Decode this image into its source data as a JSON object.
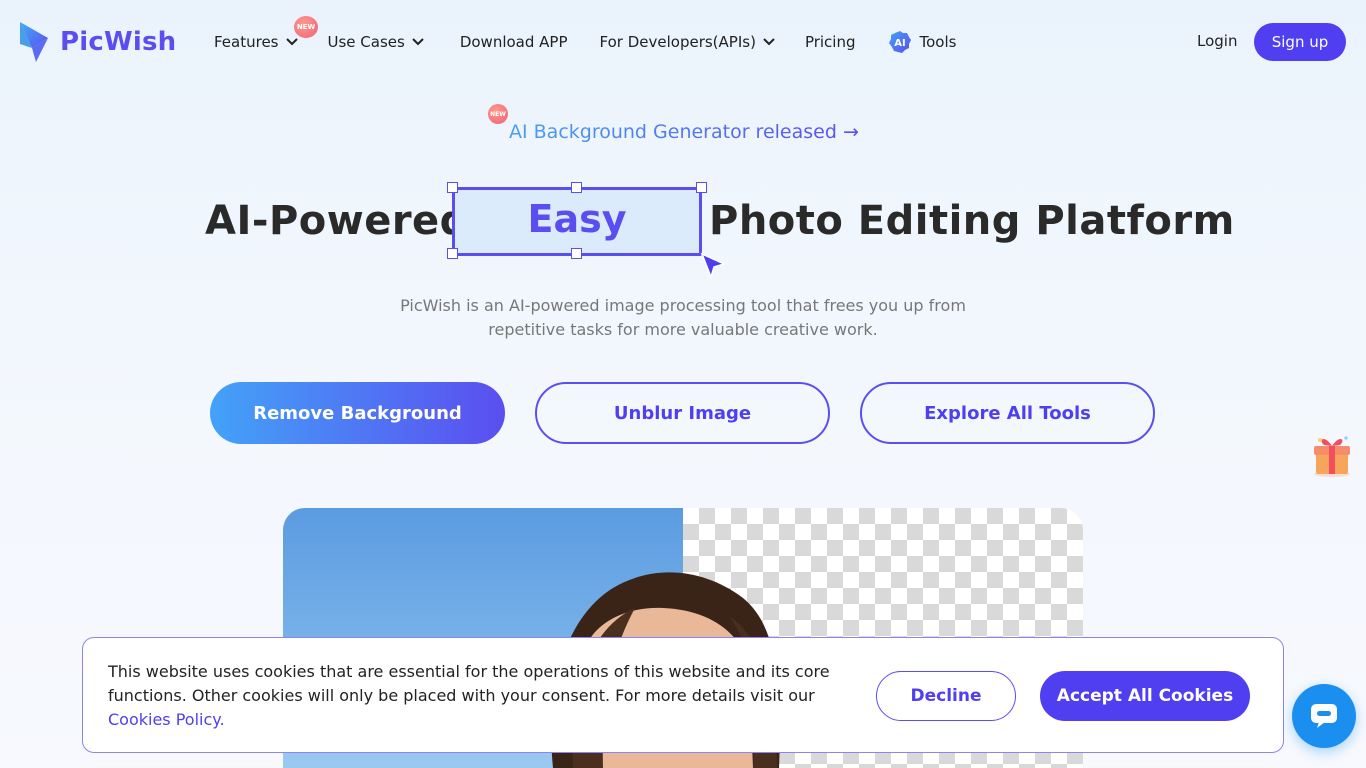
{
  "header": {
    "logo_text": "PicWish",
    "nav": [
      {
        "label": "Features",
        "has_dropdown": true,
        "badge": "NEW"
      },
      {
        "label": "Use Cases",
        "has_dropdown": true
      },
      {
        "label": "Download APP",
        "has_dropdown": false
      },
      {
        "label": "For Developers(APIs)",
        "has_dropdown": true
      },
      {
        "label": "Pricing",
        "has_dropdown": false
      },
      {
        "label": "Tools",
        "has_dropdown": false,
        "icon": "ai-icon",
        "icon_text": "AI"
      }
    ],
    "login_label": "Login",
    "signup_label": "Sign up"
  },
  "announcement": {
    "badge": "NEW",
    "text": "AI Background Generator released →"
  },
  "hero": {
    "title_before": "AI-Powered",
    "title_highlight": "Easy",
    "title_after": "Photo Editing Platform",
    "subtitle": "PicWish is an AI-powered image processing tool that frees you up from repetitive tasks for more valuable creative work."
  },
  "cta": {
    "remove_bg": "Remove Background",
    "unblur": "Unblur Image",
    "explore": "Explore All Tools"
  },
  "cookie_banner": {
    "text": "This website uses cookies that are essential for the operations of this website and its core functions. Other cookies will only be placed with your consent. For more details visit our",
    "link": "Cookies Policy.",
    "decline_label": "Decline",
    "accept_label": "Accept All Cookies"
  },
  "colors": {
    "brand": "#5b4ef0",
    "accent_blue": "#43a2f8",
    "chat": "#1b8ff0"
  }
}
